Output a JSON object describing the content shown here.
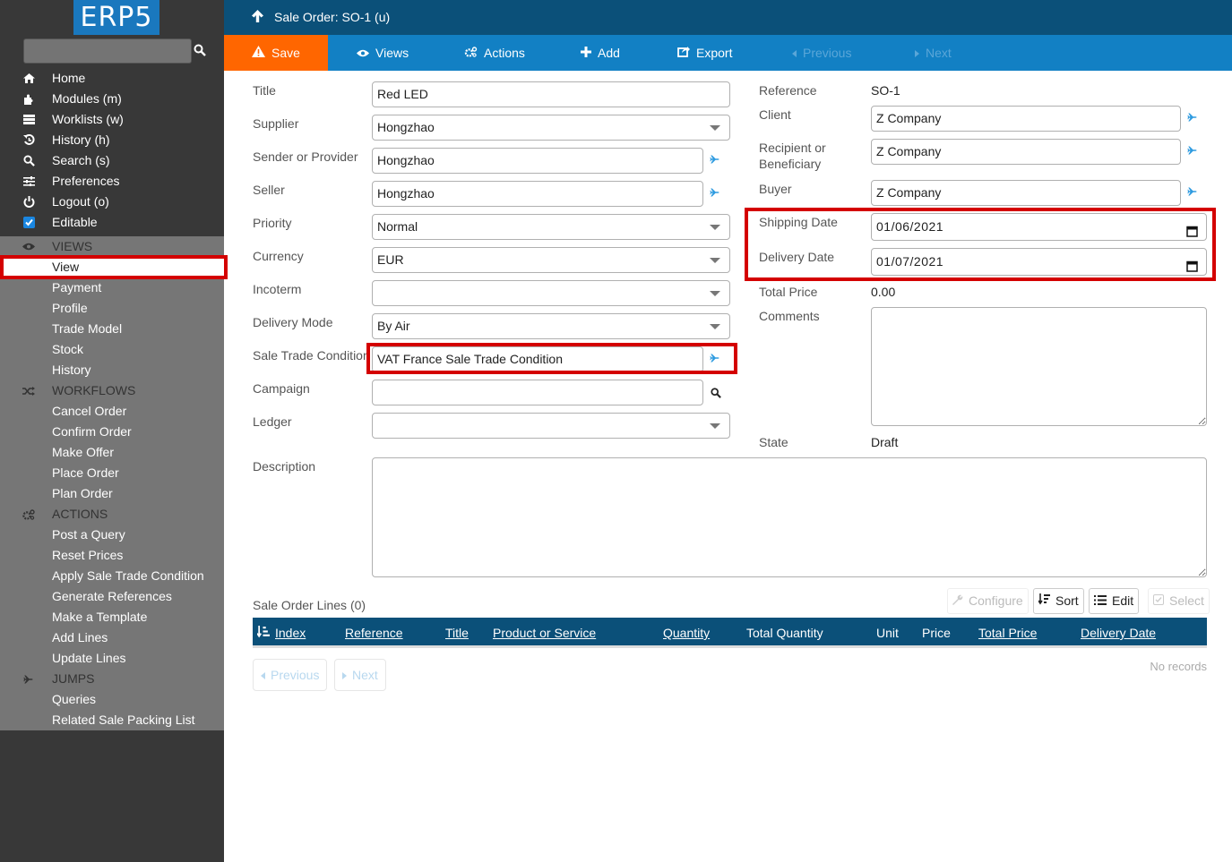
{
  "app": {
    "logo": "ERP5"
  },
  "sidebar": {
    "search": {
      "value": "",
      "placeholder": ""
    },
    "main_items": [
      {
        "label": "Home",
        "icon": "home-icon"
      },
      {
        "label": "Modules (m)",
        "icon": "puzzle-icon"
      },
      {
        "label": "Worklists (w)",
        "icon": "tasks-icon"
      },
      {
        "label": "History (h)",
        "icon": "history-icon"
      },
      {
        "label": "Search (s)",
        "icon": "search-icon"
      },
      {
        "label": "Preferences",
        "icon": "sliders-icon"
      },
      {
        "label": "Logout (o)",
        "icon": "power-icon"
      },
      {
        "label": "Editable",
        "icon": "checkbox-icon",
        "checked": true
      }
    ],
    "views": {
      "heading": "VIEWS",
      "items": [
        "View",
        "Payment",
        "Profile",
        "Trade Model",
        "Stock",
        "History"
      ],
      "active": "View"
    },
    "workflows": {
      "heading": "WORKFLOWS",
      "items": [
        "Cancel Order",
        "Confirm Order",
        "Make Offer",
        "Place Order",
        "Plan Order"
      ]
    },
    "actions": {
      "heading": "ACTIONS",
      "items": [
        "Post a Query",
        "Reset Prices",
        "Apply Sale Trade Condition",
        "Generate References",
        "Make a Template",
        "Add Lines",
        "Update Lines"
      ]
    },
    "jumps": {
      "heading": "JUMPS",
      "items": [
        "Queries",
        "Related Sale Packing List"
      ]
    }
  },
  "header": {
    "title": "Sale Order: SO-1 (u)"
  },
  "toolbar": {
    "save": "Save",
    "views": "Views",
    "actions": "Actions",
    "add": "Add",
    "export": "Export",
    "previous": "Previous",
    "next": "Next"
  },
  "form": {
    "left": {
      "title": {
        "label": "Title",
        "value": "Red LED"
      },
      "supplier": {
        "label": "Supplier",
        "value": "Hongzhao"
      },
      "sender": {
        "label": "Sender or Provider",
        "value": "Hongzhao"
      },
      "seller": {
        "label": "Seller",
        "value": "Hongzhao"
      },
      "priority": {
        "label": "Priority",
        "value": "Normal"
      },
      "currency": {
        "label": "Currency",
        "value": "EUR"
      },
      "incoterm": {
        "label": "Incoterm",
        "value": ""
      },
      "delivery_mode": {
        "label": "Delivery Mode",
        "value": "By Air"
      },
      "sale_trade_condition": {
        "label": "Sale Trade Condition",
        "value": "VAT France Sale Trade Condition"
      },
      "campaign": {
        "label": "Campaign",
        "value": ""
      },
      "ledger": {
        "label": "Ledger",
        "value": ""
      }
    },
    "right": {
      "reference": {
        "label": "Reference",
        "value": "SO-1"
      },
      "client": {
        "label": "Client",
        "value": "Z Company"
      },
      "recipient": {
        "label": "Recipient or Beneficiary",
        "value": "Z Company"
      },
      "buyer": {
        "label": "Buyer",
        "value": "Z Company"
      },
      "shipping_date": {
        "label": "Shipping Date",
        "value": "01/06/2021"
      },
      "delivery_date": {
        "label": "Delivery Date",
        "value": "01/07/2021"
      },
      "total_price": {
        "label": "Total Price",
        "value": "0.00"
      },
      "comments": {
        "label": "Comments",
        "value": ""
      },
      "state": {
        "label": "State",
        "value": "Draft"
      }
    },
    "description": {
      "label": "Description",
      "value": ""
    }
  },
  "lines": {
    "title": "Sale Order Lines (0)",
    "buttons": {
      "configure": "Configure",
      "sort": "Sort",
      "edit": "Edit",
      "select": "Select"
    },
    "columns": [
      {
        "label": "Index",
        "sortable": true
      },
      {
        "label": "Reference",
        "sortable": true
      },
      {
        "label": "Title",
        "sortable": true
      },
      {
        "label": "Product or Service",
        "sortable": true
      },
      {
        "label": "Quantity",
        "sortable": true
      },
      {
        "label": "Total Quantity",
        "sortable": false
      },
      {
        "label": "Unit",
        "sortable": false
      },
      {
        "label": "Price",
        "sortable": false
      },
      {
        "label": "Total Price",
        "sortable": true
      },
      {
        "label": "Delivery Date",
        "sortable": true
      }
    ],
    "rows": [],
    "pagination": {
      "previous": "Previous",
      "next": "Next"
    },
    "empty_text": "No records"
  }
}
